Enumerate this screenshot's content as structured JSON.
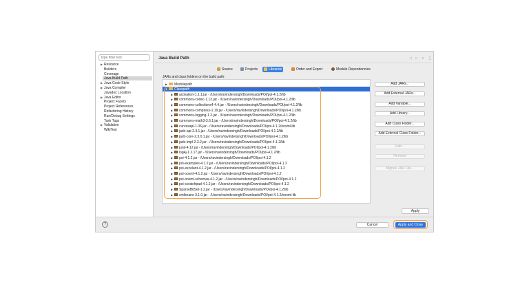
{
  "filter": {
    "placeholder": "type filter text"
  },
  "nav": {
    "items": [
      {
        "label": "Resource",
        "expandable": true
      },
      {
        "label": "Builders",
        "expandable": false
      },
      {
        "label": "Coverage",
        "expandable": false
      },
      {
        "label": "Java Build Path",
        "expandable": false,
        "selected": true
      },
      {
        "label": "Java Code Style",
        "expandable": true
      },
      {
        "label": "Java Compiler",
        "expandable": true
      },
      {
        "label": "Javadoc Location",
        "expandable": false
      },
      {
        "label": "Java Editor",
        "expandable": true
      },
      {
        "label": "Project Facets",
        "expandable": false
      },
      {
        "label": "Project References",
        "expandable": false
      },
      {
        "label": "Refactoring History",
        "expandable": false
      },
      {
        "label": "Run/Debug Settings",
        "expandable": false
      },
      {
        "label": "Task Tags",
        "expandable": false
      },
      {
        "label": "Validation",
        "expandable": true
      },
      {
        "label": "WikiText",
        "expandable": false
      }
    ]
  },
  "header": {
    "title": "Java Build Path",
    "nav_arrows": "◁ ▷ ▾",
    "kebab": "⋮"
  },
  "tabs": [
    {
      "label": "Source",
      "active": false,
      "icon_color": "#c7a24a"
    },
    {
      "label": "Projects",
      "active": false,
      "icon_color": "#7b8fa8"
    },
    {
      "label": "Libraries",
      "active": true,
      "icon_color": "#f3c24e"
    },
    {
      "label": "Order and Export",
      "active": false,
      "icon_color": "#d98b2b"
    },
    {
      "label": "Module Dependencies",
      "active": false,
      "icon_color": "#7a5c3a"
    }
  ],
  "description": "JARs and class folders on the build path:",
  "tree": {
    "modulepath": "Modulepath",
    "classpath": "Classpath",
    "jars": [
      "activation-1.1.1.jar - /Users/ravindersingh/Downloads/POI/poi-4.1.2/lib",
      "commons-codec-1.13.jar - /Users/ravindersingh/Downloads/POI/poi-4.1.2/lib",
      "commons-collections4-4.4.jar - /Users/ravindersingh/Downloads/POI/poi-4.1.2/lib",
      "commons-compress-1.19.jar - /Users/ravindersingh/Downloads/POI/poi-4.1.2/lib",
      "commons-logging-1.2.jar - /Users/ravindersingh/Downloads/POI/poi-4.1.2/lib",
      "commons-math3-3.6.1.jar - /Users/ravindersingh/Downloads/POI/poi-4.1.2/lib",
      "curvesapi-1.06.jar - /Users/ravindersingh/Downloads/POI/poi-4.1.2/ooxml-lib",
      "jaxb-api-2.3.1.jar - /Users/ravindersingh/Downloads/POI/poi-4.1.2/lib",
      "jaxb-core-2.3.0.1.jar - /Users/ravindersingh/Downloads/POI/poi-4.1.2/lib",
      "jaxb-impl-2.3.2.jar - /Users/ravindersingh/Downloads/POI/poi-4.1.2/lib",
      "junit-4.12.jar - /Users/ravindersingh/Downloads/POI/poi-4.1.2/lib",
      "log4j-1.2.17.jar - /Users/ravindersingh/Downloads/POI/poi-4.1.2/lib",
      "poi-4.1.2.jar - /Users/ravindersingh/Downloads/POI/poi-4.1.2",
      "poi-examples-4.1.2.jar - /Users/ravindersingh/Downloads/POI/poi-4.1.2",
      "poi-excelant-4.1.2.jar - /Users/ravindersingh/Downloads/POI/poi-4.1.2",
      "poi-ooxml-4.1.2.jar - /Users/ravindersingh/Downloads/POI/poi-4.1.2",
      "poi-ooxml-schemas-4.1.2.jar - /Users/ravindersingh/Downloads/POI/poi-4.1.2",
      "poi-scratchpad-4.1.2.jar - /Users/ravindersingh/Downloads/POI/poi-4.1.2",
      "SparseBitSet-1.2.jar - /Users/ravindersingh/Downloads/POI/poi-4.1.2/lib",
      "xmlbeans-3.1.0.jar - /Users/ravindersingh/Downloads/POI/poi-4.1.2/ooxml-lib"
    ]
  },
  "buttons": {
    "add_jars": "Add JARs...",
    "add_external_jars": "Add External JARs...",
    "add_variable": "Add Variable...",
    "add_library": "Add Library...",
    "add_class_folder": "Add Class Folder...",
    "add_external_class_folder": "Add External Class Folder...",
    "edit": "Edit...",
    "remove": "Remove",
    "migrate": "Migrate JAR File...",
    "apply": "Apply",
    "help": "?",
    "cancel": "Cancel",
    "apply_and_close": "Apply and Close"
  },
  "colors": {
    "accent": "#2f74dd",
    "highlight": "#f0a24a",
    "selection": "#2f6fd6"
  }
}
